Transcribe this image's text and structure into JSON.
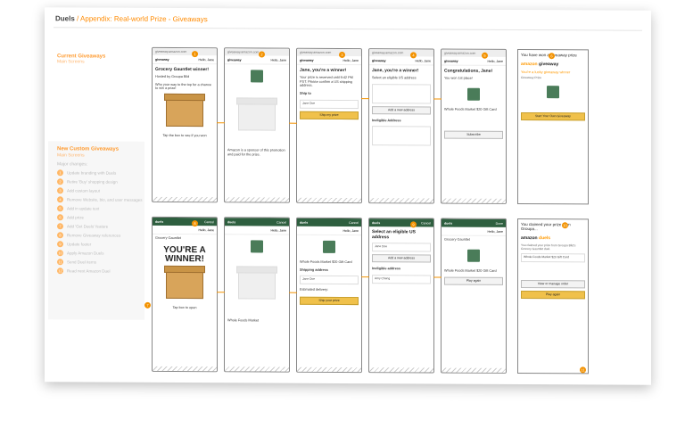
{
  "slide": {
    "brand": "Duels",
    "title": "/ Appendix: Real-world Prize - Giveaways"
  },
  "sidebar": {
    "current_heading": "Current Giveaways",
    "current_sub": "Main Screens",
    "new_heading": "New Custom Giveaways",
    "new_sub": "Main Screens",
    "changes_label": "Major changes:",
    "items": [
      {
        "num": "1",
        "label": "Update branding with Duels"
      },
      {
        "num": "2",
        "label": "Retire 'Buy' shopping design"
      },
      {
        "num": "3",
        "label": "Add custom layout"
      },
      {
        "num": "4",
        "label": "Remove Website, bio, and user messages"
      },
      {
        "num": "5",
        "label": "Add in update text"
      },
      {
        "num": "6",
        "label": "Add prize"
      },
      {
        "num": "7",
        "label": "Add 'Get Duels' feature"
      },
      {
        "num": "8",
        "label": "Remove Giveaway references"
      },
      {
        "num": "9",
        "label": "Update footer"
      },
      {
        "num": "10",
        "label": "Apply Amazon Duels"
      },
      {
        "num": "11",
        "label": "Send Duel items"
      },
      {
        "num": "12",
        "label": "Read next Amazon Duel"
      }
    ]
  },
  "top_row": [
    {
      "url": "giveaway.amazon.com",
      "hello": "Hello, Jane",
      "title": "Grocery Gauntlet winner!",
      "hosted": "Hosted by Groupa Bild",
      "body": "Who your way to the top for a chance to win a prize!",
      "cta": "Tap the box to see if you won"
    },
    {
      "url": "giveaway.amazon.com",
      "hello": "Hello, Jane",
      "body": "Amazon is a sponsor of this promotion and paid for the prize."
    },
    {
      "url": "giveaway.amazon.com",
      "hello": "Hello, Jane",
      "title": "Jane, you're a winner!",
      "body": "Your prize is reserved until 9:42 PM PST. Please confirm a US shipping address.",
      "ship_to": "Ship to",
      "name": "Jane Doe",
      "button": "Ship my prize"
    },
    {
      "url": "giveaway.amazon.com",
      "hello": "Hello, Jane",
      "title": "Jane, you're a winner!",
      "body": "Select an eligible US address",
      "add": "Add a new address",
      "ineligible": "Ineligible Address"
    },
    {
      "url": "giveaway.amazon.com",
      "hello": "Hello, Jane",
      "title": "Congratulations, Jane!",
      "body": "You won 1st place!",
      "prize": "Whole Foods Market $20 Gift Card",
      "subscribe": "Subscribe"
    }
  ],
  "top_mail": {
    "subject": "You have won a giveaway prize",
    "logo_a": "amazon",
    "logo_b": "giveaway",
    "line1": "You're a lucky giveaway winner",
    "line2": "Giveaway Prize",
    "button": "Start Your Own Giveaway"
  },
  "bottom_row": [
    {
      "brand": "duels",
      "cancel": "Cancel",
      "hello": "Hello, Jane",
      "host": "Grocery Gauntlet",
      "winner_a": "YOU'RE A",
      "winner_b": "WINNER!",
      "cta": "Tap box to open"
    },
    {
      "brand": "duels",
      "cancel": "Cancel",
      "hello": "Hello, Jane",
      "body": "Whole Foods Market"
    },
    {
      "brand": "duels",
      "cancel": "Cancel",
      "hello": "Hello, Jane",
      "prize": "Whole Foods Market $20 Gift Card",
      "shipping": "Shipping address",
      "name": "Jane Doe",
      "delivery": "Estimated delivery:",
      "button": "Ship your prize"
    },
    {
      "brand": "duels",
      "cancel": "Cancel",
      "hello": "Hello, Jane",
      "title": "Select an eligible US address",
      "name": "Jane Doe",
      "add": "Add a new address",
      "ineligible": "Ineligible address",
      "name2": "Amy Cheng"
    },
    {
      "brand": "duels",
      "cancel": "Done",
      "hello": "Hello, Jane",
      "host": "Grocery Gauntlet",
      "prize": "Whole Foods Market $20 Gift Card",
      "button": "Play again"
    }
  ],
  "bottom_mail": {
    "subject": "You claimed your prize from Groupa...",
    "logo_a": "amazon",
    "logo_b": "duels",
    "line1": "You claimed your prize from Groupa Bild's Grocery Gauntlet duel.",
    "prize": "Whole Foods Market $20 Gift Card",
    "button_a": "View or manage order",
    "button_b": "Play again"
  },
  "colors": {
    "accent": "#f39200",
    "duels_green": "#2e5f3f",
    "amazon_orange": "#ff9900"
  }
}
